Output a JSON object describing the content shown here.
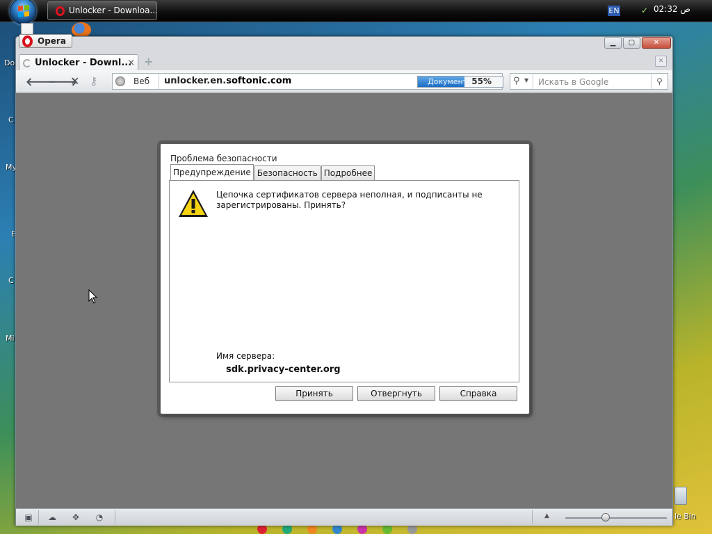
{
  "taskbar": {
    "window_button_label": "Unlocker - Downloa...",
    "language": "EN",
    "clock": "02:32 ص"
  },
  "desktop": {
    "side_labels": [
      "Do",
      "C",
      "My",
      "E",
      "C",
      "Mi"
    ],
    "recycle_bin_label": "le Bin"
  },
  "browser": {
    "menu_label": "Opera",
    "tab": {
      "title": "Unlocker - Downl...",
      "close_glyph": "×"
    },
    "new_tab_glyph": "+",
    "address": {
      "scope_label": "Веб",
      "url_prefix": "unlocker.en.",
      "url_domain": "softonic.com",
      "progress_label": "Документ",
      "progress_value": "55%",
      "progress_fraction": 0.55
    },
    "search_placeholder": "Искать в Google"
  },
  "dialog": {
    "title": "Проблема безопасности",
    "tabs": [
      "Предупреждение",
      "Безопасность",
      "Подробнее"
    ],
    "active_tab": 0,
    "message": "Цепочка сертификатов сервера неполная, и подписанты не зарегистрированы. Принять?",
    "server_label": "Имя сервера:",
    "server_value": "sdk.privacy-center.org",
    "buttons": {
      "accept": "Принять",
      "reject": "Отвергнуть",
      "help": "Справка"
    }
  },
  "statusbar": {
    "zoom_fraction": 0.4
  },
  "colors": {
    "progress_fill": "#1a6cc4",
    "close_button": "#c64f3b",
    "viewport_bg": "#767676"
  }
}
